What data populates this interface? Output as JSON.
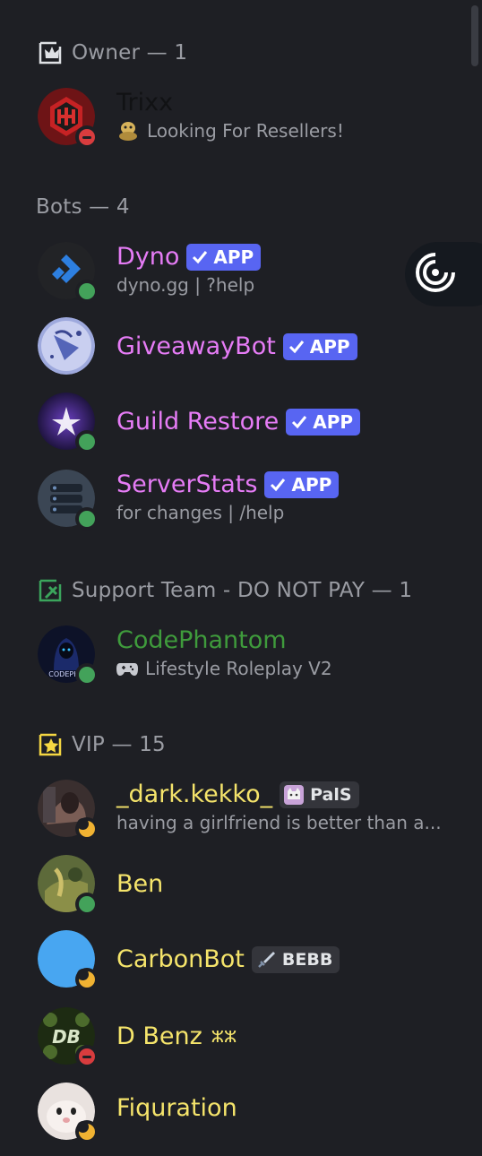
{
  "sections": {
    "owner": {
      "label": "Owner — 1"
    },
    "bots": {
      "label": "Bots — 4"
    },
    "support": {
      "label": "Support Team - DO NOT PAY — 1"
    },
    "vip": {
      "label": "VIP — 15"
    }
  },
  "members": {
    "trixx": {
      "name": "Trixx",
      "activity": "Looking For Resellers!",
      "status": "dnd",
      "name_color": "#111214"
    },
    "dyno": {
      "name": "Dyno",
      "tag": "APP",
      "activity": "dyno.gg | ?help",
      "status": "online",
      "name_color": "#e67cf6"
    },
    "giveawaybot": {
      "name": "GiveawayBot",
      "tag": "APP",
      "name_color": "#e67cf6"
    },
    "guildrestore": {
      "name": "Guild Restore",
      "tag": "APP",
      "status": "online",
      "name_color": "#e67cf6"
    },
    "serverstats": {
      "name": "ServerStats",
      "tag": "APP",
      "activity": "for changes | /help",
      "status": "online",
      "name_color": "#e67cf6"
    },
    "codephantom": {
      "name": "CodePhantom",
      "activity": "Lifestyle Roleplay V2",
      "status": "online",
      "name_color": "#3f9b3c",
      "avatar_text": "CODEPHA"
    },
    "darkkekko": {
      "name": "_dark.kekko_",
      "guild_tag": "PalS",
      "activity": "having a girlfriend is better than a...",
      "status": "idle",
      "name_color": "#f5e46b"
    },
    "ben": {
      "name": "Ben",
      "status": "online",
      "name_color": "#f5e46b"
    },
    "carbonbot": {
      "name": "CarbonBot",
      "guild_tag": "BEBB",
      "status": "idle",
      "name_color": "#f5e46b"
    },
    "dbenz": {
      "name": "D Benz",
      "name_suffix": "ⵣⵣ",
      "status": "dnd",
      "name_color": "#f5e46b",
      "avatar_text": "DB"
    },
    "fiquration": {
      "name": "Fiquration",
      "status": "idle",
      "name_color": "#f5e46b"
    }
  },
  "colors": {
    "background": "#1e1f24",
    "app_tag": "#5865f2",
    "muted_text": "#9a9ca3",
    "online": "#43a25a",
    "dnd": "#d83c3e",
    "idle": "#f0b232"
  },
  "icons": [
    "crown-role-icon",
    "tools-role-icon",
    "star-role-icon",
    "checkmark-icon",
    "gamepad-icon",
    "sword-icon",
    "cat-icon",
    "target-icon"
  ]
}
